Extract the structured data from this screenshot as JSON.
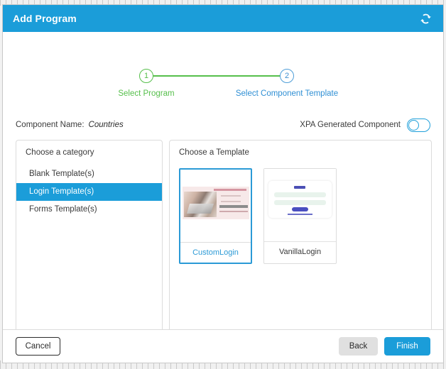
{
  "window": {
    "title": "Add Program",
    "refresh_icon": "refresh-icon",
    "accent_color": "#1b9dd9"
  },
  "stepper": {
    "steps": [
      {
        "number": "1",
        "label": "Select Program",
        "state": "completed",
        "color": "#56bf4b"
      },
      {
        "number": "2",
        "label": "Select Component Template",
        "state": "active",
        "color": "#2f8fd4"
      }
    ],
    "connector_color": "#56bf4b"
  },
  "meta": {
    "component_name_label": "Component Name:",
    "component_name_value": "Countries",
    "xpa_toggle_label": "XPA Generated Component",
    "xpa_toggle_state": "off",
    "xpa_toggle_color": "#20a0da"
  },
  "category_panel": {
    "title": "Choose a category",
    "items": [
      {
        "label": "Blank Template(s)",
        "selected": false
      },
      {
        "label": "Login Template(s)",
        "selected": true
      },
      {
        "label": "Forms Template(s)",
        "selected": false
      }
    ],
    "selected_color": "#1b9dd9"
  },
  "template_panel": {
    "title": "Choose a Template",
    "templates": [
      {
        "name": "CustomLogin",
        "selected": true,
        "preview": "custom-login-preview"
      },
      {
        "name": "VanillaLogin",
        "selected": false,
        "preview": "vanilla-login-preview"
      }
    ],
    "selected_border_color": "#2b9ad6"
  },
  "footer": {
    "cancel_label": "Cancel",
    "back_label": "Back",
    "finish_label": "Finish",
    "finish_color": "#1b9dd9"
  }
}
